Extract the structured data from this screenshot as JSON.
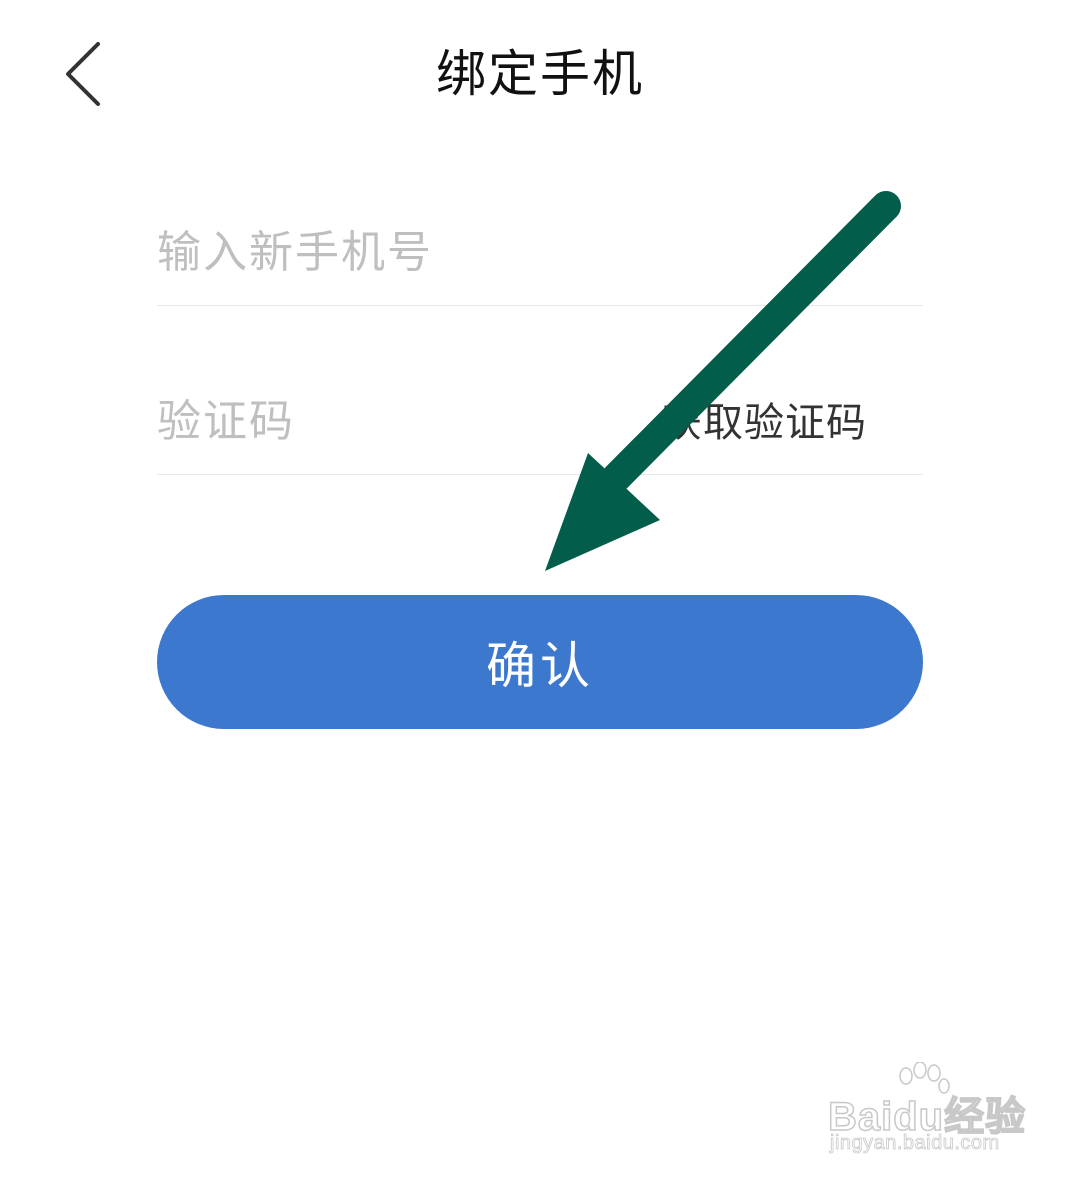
{
  "header": {
    "back_icon": "chevron-left-icon",
    "title": "绑定手机"
  },
  "form": {
    "phone_placeholder": "输入新手机号",
    "phone_value": "",
    "code_placeholder": "验证码",
    "code_value": "",
    "get_code_label": "获取验证码"
  },
  "confirm_button": {
    "label": "确认",
    "color": "#3d78cf"
  },
  "annotation": {
    "arrow_icon": "arrow-down-left-icon",
    "arrow_color": "#025e4b"
  },
  "watermark": {
    "logo_text": "Baidu经验",
    "url": "jingyan.baidu.com"
  }
}
